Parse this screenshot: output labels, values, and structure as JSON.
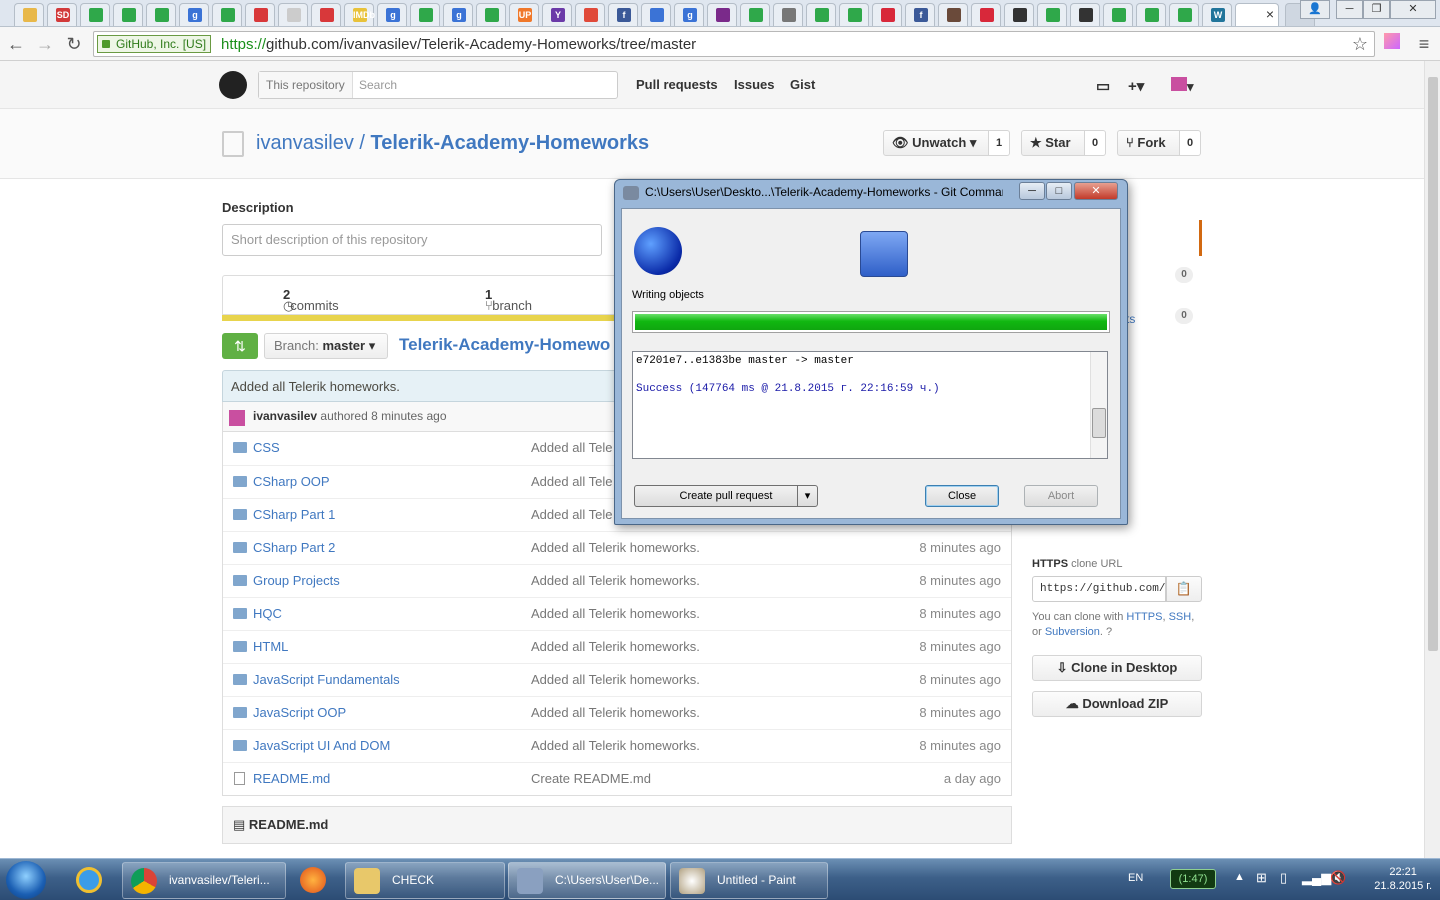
{
  "browser": {
    "ev_label": "GitHub, Inc. [US]",
    "url_proto": "https://",
    "url_rest": "github.com/ivanvasilev/Telerik-Academy-Homeworks/tree/master",
    "tab_favicon_colors": [
      "#e8b84a",
      "#d23a3a",
      "#2fa84a",
      "#2fa84a",
      "#2fa84a",
      "#3b73d6",
      "#2fa84a",
      "#d8383a",
      "#cccccc",
      "#d8383a",
      "#e8c23a",
      "#3b73d6",
      "#2fa84a",
      "#3b73d6",
      "#2fa84a",
      "#f0782a",
      "#6b3aa8",
      "#e04a3a",
      "#3b5998",
      "#3b73d6",
      "#3b73d6",
      "#7a2a8a",
      "#2fa84a",
      "#777777",
      "#2fa84a",
      "#2fa84a",
      "#d8283a",
      "#3b5998",
      "#6a4a3a",
      "#d8283a",
      "#333333",
      "#2fa84a",
      "#333333",
      "#2fa84a",
      "#2fa84a",
      "#2fa84a",
      "#21759b"
    ],
    "tab_favicon_labels": [
      "",
      "SD",
      "",
      "",
      "",
      "g",
      "",
      "",
      "",
      "",
      "IMDb",
      "g",
      "",
      "g",
      "",
      "UP",
      "Y",
      "",
      "f",
      "",
      "g",
      "",
      "",
      "",
      "",
      "",
      "",
      "f",
      "",
      "",
      "",
      "",
      "",
      "",
      "",
      "",
      "W"
    ]
  },
  "github": {
    "search_scope": "This repository",
    "search_placeholder": "Search",
    "nav": [
      "Pull requests",
      "Issues",
      "Gist"
    ],
    "repo_owner": "ivanvasilev",
    "repo_sep": " / ",
    "repo_name": "Telerik-Academy-Homeworks",
    "unwatch_label": "Unwatch ▾",
    "unwatch_count": "1",
    "star_label": "★ Star",
    "star_count": "0",
    "fork_label": "Fork",
    "fork_count": "0",
    "description_label": "Description",
    "description_placeholder": "Short description of this repository",
    "commits_count": "2",
    "commits_label": "commits",
    "branch_count": "1",
    "branch_label": "branch",
    "branch_prefix": "Branch:",
    "branch_name": "master",
    "breadcrumb": "Telerik-Academy-Homewo",
    "commit_message": "Added all Telerik homeworks.",
    "commit_author": "ivanvasilev",
    "commit_meta": "authored 8 minutes ago",
    "files": [
      {
        "name": "CSS",
        "msg": "Added all Tele",
        "age": ""
      },
      {
        "name": "CSharp OOP",
        "msg": "Added all Tele",
        "age": ""
      },
      {
        "name": "CSharp Part 1",
        "msg": "Added all Tele",
        "age": ""
      },
      {
        "name": "CSharp Part 2",
        "msg": "Added all Telerik homeworks.",
        "age": "8 minutes ago"
      },
      {
        "name": "Group Projects",
        "msg": "Added all Telerik homeworks.",
        "age": "8 minutes ago"
      },
      {
        "name": "HQC",
        "msg": "Added all Telerik homeworks.",
        "age": "8 minutes ago"
      },
      {
        "name": "HTML",
        "msg": "Added all Telerik homeworks.",
        "age": "8 minutes ago"
      },
      {
        "name": "JavaScript Fundamentals",
        "msg": "Added all Telerik homeworks.",
        "age": "8 minutes ago"
      },
      {
        "name": "JavaScript OOP",
        "msg": "Added all Telerik homeworks.",
        "age": "8 minutes ago"
      },
      {
        "name": "JavaScript UI And DOM",
        "msg": "Added all Telerik homeworks.",
        "age": "8 minutes ago"
      },
      {
        "name": "README.md",
        "msg": "Create README.md",
        "age": "a day ago",
        "type": "file"
      }
    ],
    "readme_title": "README.md",
    "sidebar": {
      "count_a": "0",
      "count_b": "0",
      "partial_link": "ts",
      "https_label": "HTTPS",
      "clone_url_label": "clone URL",
      "clone_url": "https://github.com/:",
      "clone_help_prefix": "You can clone with",
      "clone_help_https": "HTTPS",
      "clone_help_ssh": "SSH",
      "clone_help_or": ", or",
      "clone_help_svn": "Subversion",
      "clone_desktop": "Clone in Desktop",
      "download_zip": "Download ZIP"
    }
  },
  "git_dialog": {
    "title": "C:\\Users\\User\\Deskto...\\Telerik-Academy-Homeworks - Git Comman...",
    "status": "Writing objects",
    "progress": 1.0,
    "log_line1": "e7201e7..e1383be  master -> master",
    "log_line2": "Success (147764 ms @ 21.8.2015 г. 22:16:59 ч.)",
    "btn_pull": "Create pull request",
    "btn_close": "Close",
    "btn_abort": "Abort"
  },
  "taskbar": {
    "items": [
      "ivanvasilev/Teleri...",
      "CHECK",
      "C:\\Users\\User\\De...",
      "Untitled - Paint"
    ],
    "lang": "EN",
    "battery": "(1:47)",
    "time": "22:21",
    "date": "21.8.2015 г."
  }
}
